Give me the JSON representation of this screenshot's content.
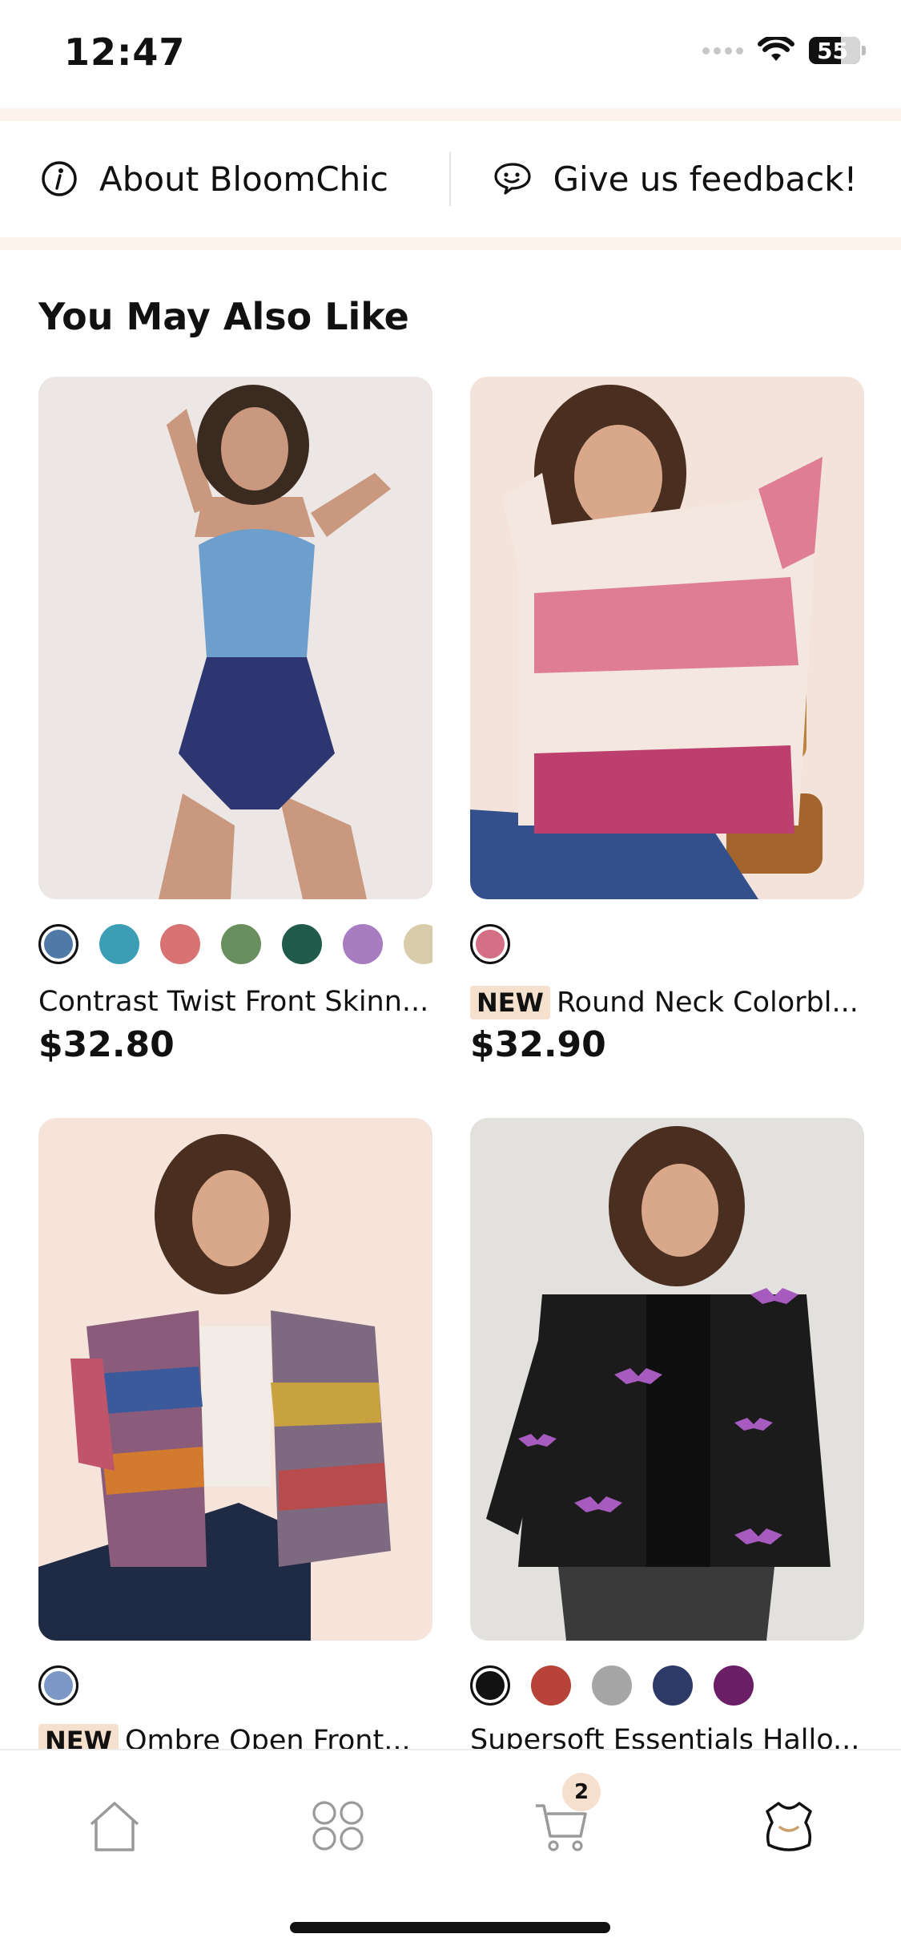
{
  "status_bar": {
    "time": "12:47",
    "battery": "55"
  },
  "info_links": [
    {
      "label": "About BloomChic",
      "icon": "info-icon"
    },
    {
      "label": "Give us feedback!",
      "icon": "feedback-icon"
    }
  ],
  "section_title": "You May Also Like",
  "products": [
    {
      "name": "Contrast Twist Front Skinn...",
      "price": "$32.80",
      "badge": "",
      "image": "blue-swimsuit-photo",
      "swatches": [
        "#4f79a6",
        "#3c9eb5",
        "#d97373",
        "#6a8f5e",
        "#1f5a4a",
        "#a77cc1",
        "#d9ccaa"
      ]
    },
    {
      "name": "Round Neck Colorbl...",
      "price": "$32.90",
      "badge": "NEW",
      "image": "pink-striped-sweater-photo",
      "swatches": [
        "#d46f85"
      ]
    },
    {
      "name": "Ombre Open Front...",
      "price": "",
      "badge": "NEW",
      "image": "multicolor-cardigan-photo",
      "swatches": [
        "#7a97c6"
      ]
    },
    {
      "name": "Supersoft Essentials Hallo...",
      "price": "",
      "badge": "",
      "image": "black-bat-cardigan-photo",
      "swatches": [
        "#111111",
        "#b8433a",
        "#a6a6a6",
        "#2e3a66",
        "#6a1f66"
      ]
    }
  ],
  "tabbar": {
    "items": [
      "home-icon",
      "categories-icon",
      "cart-icon",
      "account-dress-icon"
    ],
    "cart_count": "2"
  },
  "colors": {
    "accent_band": "#fdf2ec",
    "badge_bg": "#f4e0cd"
  }
}
